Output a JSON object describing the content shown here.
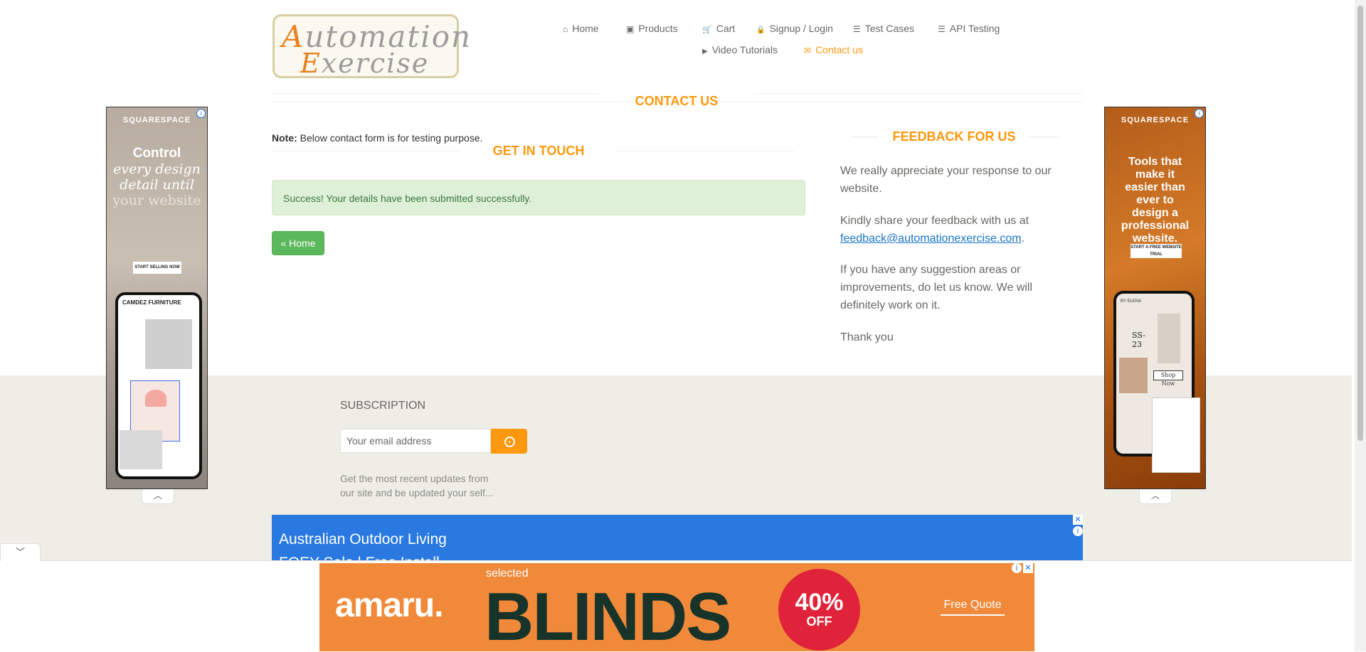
{
  "logo": {
    "line1_cap": "A",
    "line1_rest": "utomation",
    "line2_cap": "E",
    "line2_rest": "xercise"
  },
  "nav": {
    "items": [
      {
        "label": "Home",
        "icon": "⌂"
      },
      {
        "label": "Products",
        "icon": "▣"
      },
      {
        "label": "Cart",
        "icon": "🛒"
      },
      {
        "label": "Signup / Login",
        "icon": "🔒"
      },
      {
        "label": "Test Cases",
        "icon": "☰"
      },
      {
        "label": "API Testing",
        "icon": "☰"
      },
      {
        "label": "Video Tutorials",
        "icon": "▶"
      },
      {
        "label": "Contact us",
        "icon": "✉"
      }
    ]
  },
  "contact": {
    "title": "CONTACT US",
    "note_bold": "Note:",
    "note_text": " Below contact form is for testing purpose.",
    "get_in_touch": "GET IN TOUCH",
    "success": "Success! Your details have been submitted successfully.",
    "home_button": "« Home"
  },
  "feedback": {
    "title": "FEEDBACK FOR US",
    "p1": "We really appreciate your response to our website.",
    "p2_text": "Kindly share your feedback with us at ",
    "p2_link": "feedback@automationexercise.com",
    "p2_end": ".",
    "p3": "If you have any suggestion areas or improvements, do let us know. We will definitely work on it.",
    "p4": "Thank you"
  },
  "footer": {
    "subscription_title": "SUBSCRIPTION",
    "email_placeholder": "Your email address",
    "subscribe_icon": "arrow-circle-right-icon",
    "description": "Get the most recent updates from our site and be updated your self..."
  },
  "ads": {
    "left": {
      "brand": "SQUARESPACE",
      "headline_1": "Control",
      "headline_2": "every design",
      "headline_3": "detail until",
      "headline_4": "your website",
      "cta": "START SELLING NOW",
      "phone_title": "CAMDEZ FURNITURE"
    },
    "right": {
      "brand": "SQUARESPACE",
      "headline": "Tools that make it easier than ever to design a professional website.",
      "cta": "START A FREE WEBSITE TRIAL",
      "phone_brand": "BY ELENA",
      "phone_text": "SS-23",
      "phone_cta": "Shop Now"
    },
    "blue": {
      "line1": "Australian Outdoor Living",
      "line2": "FOEY Sale | Free Install"
    },
    "bottom": {
      "brand": "amaru.",
      "selected": "selected",
      "headline": "BLINDS",
      "badge": "40%",
      "badge_sub": "OFF",
      "quote": "Free Quote"
    }
  },
  "colors": {
    "accent": "#fe980f",
    "success_bg": "#dff0d8",
    "success_text": "#3c763d",
    "button_green": "#5cb85c",
    "footer_bg": "#eeeee6",
    "link": "#1a73c4"
  }
}
